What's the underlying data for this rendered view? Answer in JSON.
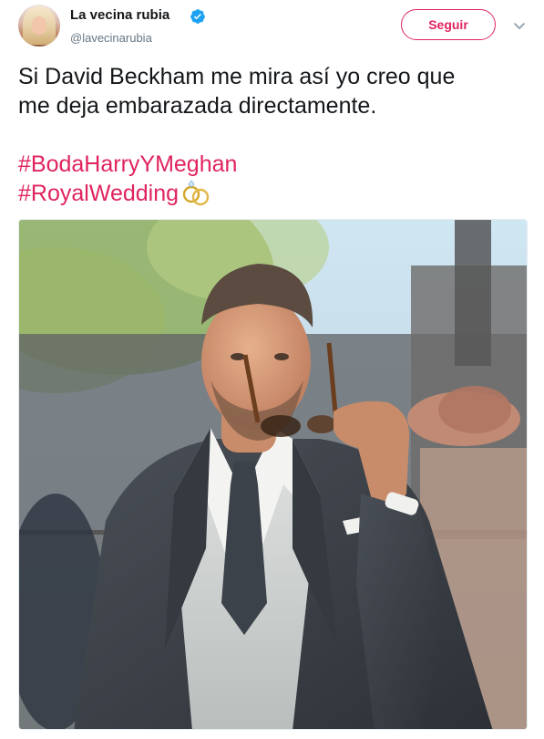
{
  "user": {
    "display_name": "La vecina rubia",
    "handle": "@lavecinarubia",
    "verified": true
  },
  "actions": {
    "follow_label": "Seguir",
    "caret_icon": "chevron-down-icon"
  },
  "tweet": {
    "text_lines": [
      "Si David Beckham me mira así yo creo que",
      "me deja embarazada directamente."
    ],
    "hashtags": [
      "#BodaHarryYMeghan",
      "#RoyalWedding"
    ],
    "emoji": "rings-icon"
  },
  "colors": {
    "accent": "#e0245e",
    "verified": "#1da1f2",
    "text": "#14171a",
    "secondary": "#657786"
  }
}
